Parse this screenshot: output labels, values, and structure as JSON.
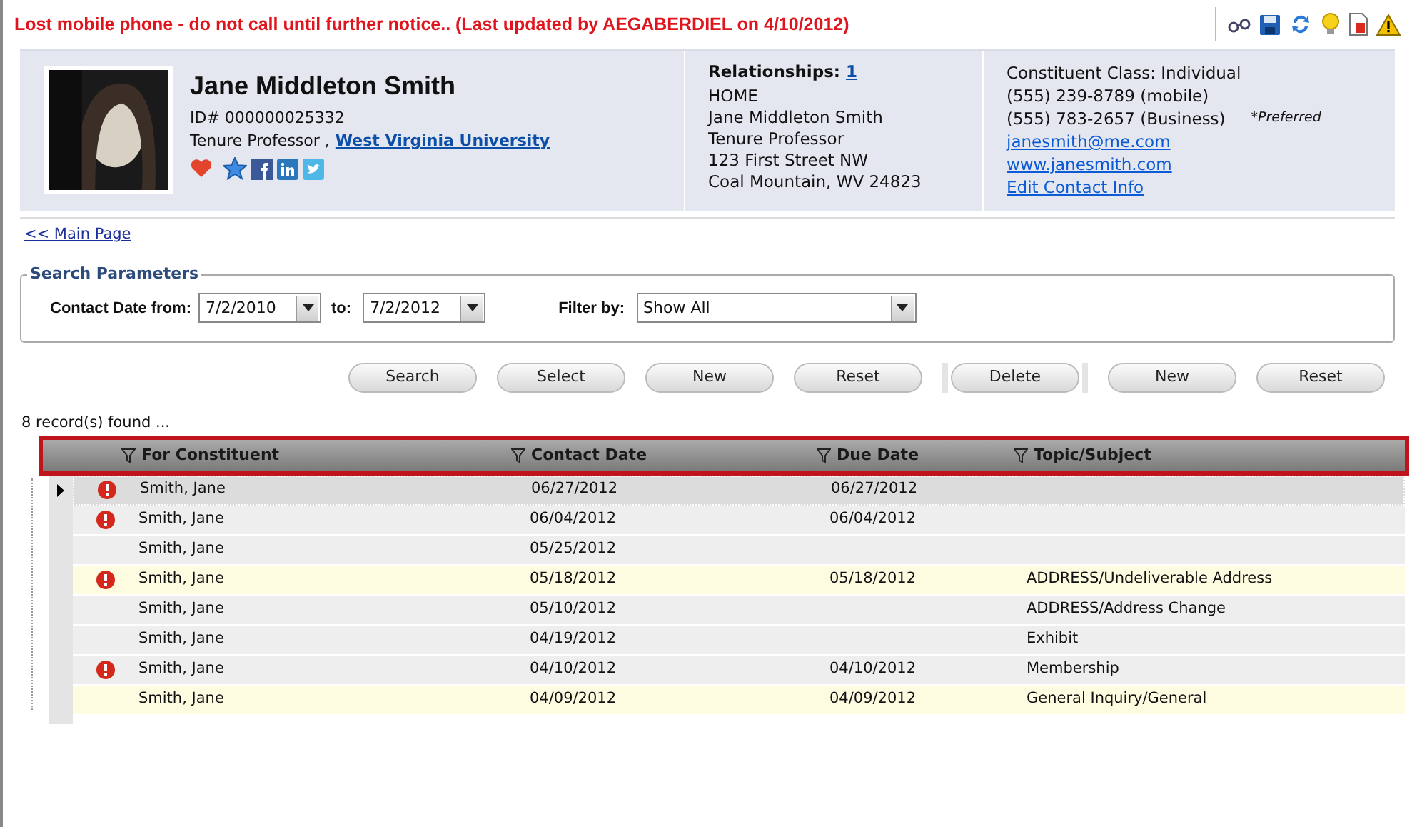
{
  "alert_banner": "Lost mobile phone - do not call until further notice.. (Last updated by AEGABERDIEL  on 4/10/2012)",
  "profile": {
    "name": "Jane Middleton Smith",
    "id": "ID# 000000025332",
    "title": "Tenure Professor ,",
    "organization": "West Virginia University"
  },
  "relationships": {
    "label": "Relationships:",
    "count": "1",
    "lines": [
      "HOME",
      "Jane Middleton Smith",
      "Tenure Professor",
      "123 First Street NW",
      "Coal Mountain, WV 24823"
    ]
  },
  "contact": {
    "class": "Constituent Class: Individual",
    "mobile": "(555) 239-8789 (mobile)",
    "business": "(555) 783-2657 (Business)",
    "preferred": "*Preferred",
    "email": "janesmith@me.com",
    "website": "www.janesmith.com",
    "edit_link": "Edit Contact Info"
  },
  "main_page_link": "<< Main Page",
  "search_parameters": {
    "legend": "Search Parameters",
    "from_label": "Contact Date from:",
    "from_value": "7/2/2010",
    "to_label": "to:",
    "to_value": "7/2/2012",
    "filter_label": "Filter by:",
    "filter_value": "Show All"
  },
  "buttons": [
    "Search",
    "Select",
    "New",
    "Reset",
    "Delete",
    "New",
    "Reset"
  ],
  "records_found": "8 record(s) found ...",
  "table": {
    "columns": [
      "For Constituent",
      "Contact Date",
      "Due Date",
      "Topic/Subject"
    ],
    "rows": [
      {
        "constituent": "Smith, Jane",
        "contact_date": "06/27/2012",
        "due_date": "06/27/2012",
        "topic": "",
        "alert": true,
        "highlighted": false,
        "selected": true
      },
      {
        "constituent": "Smith, Jane",
        "contact_date": "06/04/2012",
        "due_date": "06/04/2012",
        "topic": "",
        "alert": true,
        "highlighted": false,
        "selected": false
      },
      {
        "constituent": "Smith, Jane",
        "contact_date": "05/25/2012",
        "due_date": "",
        "topic": "",
        "alert": false,
        "highlighted": false,
        "selected": false
      },
      {
        "constituent": "Smith, Jane",
        "contact_date": "05/18/2012",
        "due_date": "05/18/2012",
        "topic": "ADDRESS/Undeliverable Address",
        "alert": true,
        "highlighted": true,
        "selected": false
      },
      {
        "constituent": "Smith, Jane",
        "contact_date": "05/10/2012",
        "due_date": "",
        "topic": "ADDRESS/Address Change",
        "alert": false,
        "highlighted": false,
        "selected": false
      },
      {
        "constituent": "Smith, Jane",
        "contact_date": "04/19/2012",
        "due_date": "",
        "topic": "Exhibit",
        "alert": false,
        "highlighted": false,
        "selected": false
      },
      {
        "constituent": "Smith, Jane",
        "contact_date": "04/10/2012",
        "due_date": "04/10/2012",
        "topic": "Membership",
        "alert": true,
        "highlighted": false,
        "selected": false
      },
      {
        "constituent": "Smith, Jane",
        "contact_date": "04/09/2012",
        "due_date": "04/09/2012",
        "topic": "General Inquiry/General",
        "alert": false,
        "highlighted": true,
        "selected": false
      }
    ]
  }
}
